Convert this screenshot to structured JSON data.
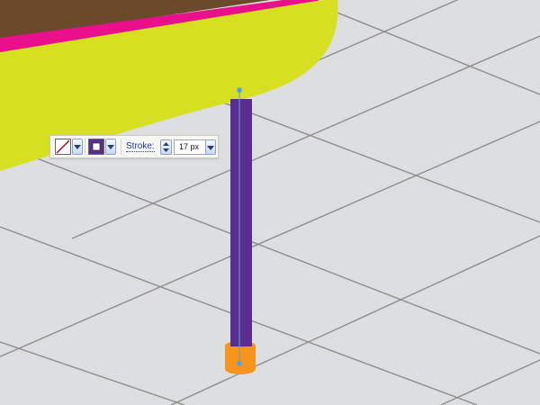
{
  "canvas": {
    "floor_color": "#dddedf",
    "grid_line_color": "#8e8e8e"
  },
  "objects": {
    "tabletop": {
      "top_color": "#6b4a2b",
      "edge_color": "#ea0f8a",
      "side_color": "#d6e021"
    },
    "leg": {
      "color": "#5c2d91",
      "foot_color": "#f7941d",
      "anchor_color": "#4aa3df"
    }
  },
  "control_bar": {
    "fill_icon": "no-fill-icon",
    "stroke_icon": "stroke-swatch-icon",
    "stroke_color": "#5c2d91",
    "stroke_label": "Stroke:",
    "stroke_weight": "17 px",
    "dropdown_icon": "chevron-down-icon",
    "stepper_icon": "stepper-icon"
  }
}
